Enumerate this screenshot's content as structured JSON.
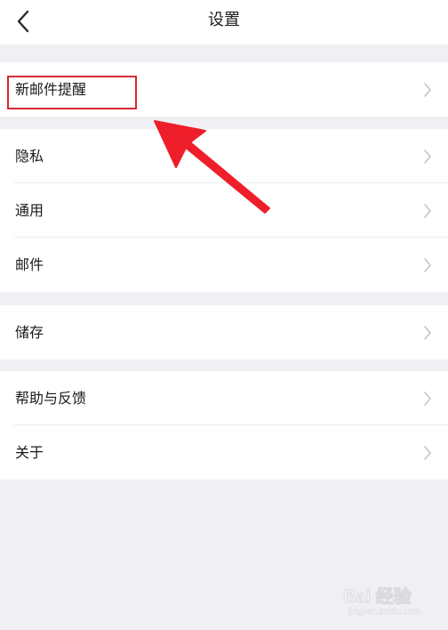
{
  "nav": {
    "title": "设置",
    "back_icon": "chevron-left-icon"
  },
  "groups": [
    {
      "items": [
        {
          "label": "新邮件提醒",
          "icon": "chevron-right-icon"
        }
      ]
    },
    {
      "items": [
        {
          "label": "隐私",
          "icon": "chevron-right-icon"
        },
        {
          "label": "通用",
          "icon": "chevron-right-icon"
        },
        {
          "label": "邮件",
          "icon": "chevron-right-icon"
        }
      ]
    },
    {
      "items": [
        {
          "label": "储存",
          "icon": "chevron-right-icon"
        }
      ]
    },
    {
      "items": [
        {
          "label": "帮助与反馈",
          "icon": "chevron-right-icon"
        },
        {
          "label": "关于",
          "icon": "chevron-right-icon"
        }
      ]
    }
  ],
  "annotation": {
    "highlight_color": "#d9282f",
    "arrow_color": "#ee1f2a"
  },
  "watermark": {
    "brand": "Bai 经验",
    "sub": "jingyan.baidu.com"
  }
}
